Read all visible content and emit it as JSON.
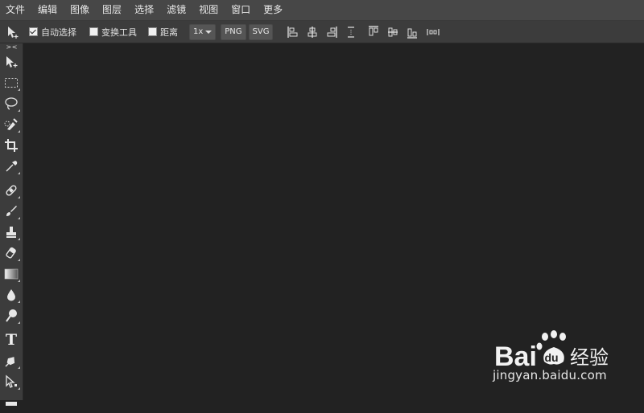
{
  "menubar": {
    "items": [
      "文件",
      "编辑",
      "图像",
      "图层",
      "选择",
      "滤镜",
      "视图",
      "窗口",
      "更多"
    ]
  },
  "options": {
    "auto_select_label": "自动选择",
    "auto_select_checked": true,
    "transform_label": "变换工具",
    "transform_checked": false,
    "distance_label": "距离",
    "distance_checked": false,
    "scale_value": "1x",
    "png_label": "PNG",
    "svg_label": "SVG"
  },
  "tools": {
    "collapse_label": "> <",
    "items": [
      "move",
      "rect-select",
      "lasso",
      "quick-select",
      "crop",
      "eyedropper",
      "healing",
      "brush",
      "stamp",
      "eraser",
      "gradient",
      "blur",
      "dodge",
      "type",
      "pen",
      "path-select"
    ],
    "type_glyph": "T"
  },
  "watermark": {
    "logo_left": "Bai",
    "logo_right": "经验",
    "url": "jingyan.baidu.com"
  }
}
